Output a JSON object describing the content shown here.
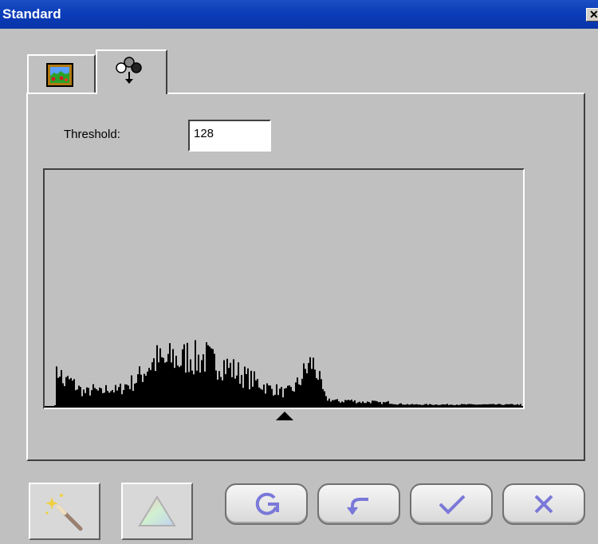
{
  "window": {
    "title": "Standard",
    "close_glyph": "✕"
  },
  "tabs": [
    {
      "name": "image-tab",
      "icon": "picture-icon"
    },
    {
      "name": "threshold-tab",
      "icon": "balls-threshold-icon",
      "selected": true
    }
  ],
  "threshold": {
    "label": "Threshold:",
    "value": "128"
  },
  "histogram": {
    "marker_value": 128,
    "note": "black histogram over 0-255 levels"
  },
  "buttons": [
    {
      "name": "auto-magic-button",
      "icon": "magic-wand-icon",
      "enabled": false
    },
    {
      "name": "color-triangle-button",
      "icon": "color-triangle-icon",
      "enabled": false
    },
    {
      "name": "reset-button",
      "icon": "refresh-icon"
    },
    {
      "name": "undo-button",
      "icon": "undo-arrow-icon"
    },
    {
      "name": "ok-button",
      "icon": "checkmark-icon"
    },
    {
      "name": "cancel-button",
      "icon": "x-icon"
    }
  ],
  "colors": {
    "title_bar": "#0a3bb8",
    "icon_accent": "#7a78d8"
  }
}
